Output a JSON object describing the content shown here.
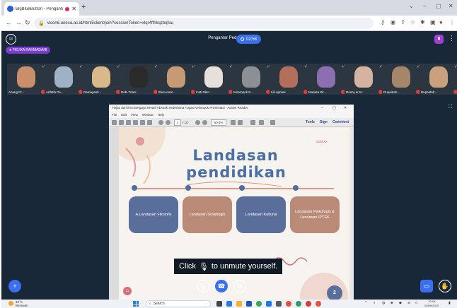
{
  "browser": {
    "tab_title": "BigBlueButton - Pengantar P",
    "new_tab": "+",
    "url": "vicon6.unesa.ac.id/html5client/join?sessionToken=xlqr4ffhkqzbqfou",
    "window_controls": [
      "⌄",
      "–",
      "▢",
      "✕"
    ]
  },
  "meeting": {
    "title": "Pengantar Pedagogik",
    "timer": "02:58",
    "presenter_badge": "FELIKA RAHMADANI"
  },
  "participants": [
    {
      "name": "Anang Pr...",
      "color": "#c98f6a"
    },
    {
      "name": "Arifatih Pe...",
      "color": "#9fb1c6"
    },
    {
      "name": "Damayanti...",
      "color": "#d9b98a"
    },
    {
      "name": "Debi Triani",
      "color": "#2a2a2a"
    },
    {
      "name": "Eliva Amir...",
      "color": "#c59a74"
    },
    {
      "name": "Insti Oktr...",
      "color": "#e5e0d9"
    },
    {
      "name": "Kelompok 8...",
      "color": "#8c8f94"
    },
    {
      "name": "Lili Apriani",
      "color": "#b46e5c"
    },
    {
      "name": "Mutiara Sit...",
      "color": "#8c6fb0"
    },
    {
      "name": "Rosny & M...",
      "color": "#d6b3a1"
    },
    {
      "name": "Rupaidah...",
      "color": "#a58669"
    },
    {
      "name": "Rupaidah...",
      "color": "#c9a07b"
    }
  ],
  "acrobat": {
    "title": "Tinjau dari Ilmu Bergaya Kreatif Abstrak Sederhana Tugas Kelompok Presentasi - Adobe Reader",
    "menu": [
      "File",
      "Edit",
      "View",
      "Window",
      "Help"
    ],
    "page_current": "1",
    "page_total": "/ 10",
    "zoom": "60,8%",
    "tools": "Tools",
    "sign": "Sign",
    "comment": "Comment"
  },
  "slide": {
    "title_line1": "Landasan",
    "title_line2": "pendidikan",
    "chevrons": ">>>>>",
    "pills": [
      {
        "label": "A.Landasan Filosofis",
        "color": "#5a6e9c"
      },
      {
        "label": "Landasan Sosiologis",
        "color": "#b98a76"
      },
      {
        "label": "Landasan Kultural",
        "color": "#5a6e9c"
      },
      {
        "label": "Landasan Psikologis & Landasan IPTEK",
        "color": "#b98a76"
      }
    ],
    "page_number": "2"
  },
  "toast": {
    "text_before": "Click",
    "text_after": "to unmute yourself."
  },
  "taskbar": {
    "weather_temp": "32°C",
    "weather_desc": "Berawan",
    "search_placeholder": "Search",
    "time": "10:49",
    "date": "20/09/2023"
  },
  "colors": {
    "app_bg": "#182838",
    "accent": "#3a6ff0",
    "presenter": "#7b3fd0"
  }
}
